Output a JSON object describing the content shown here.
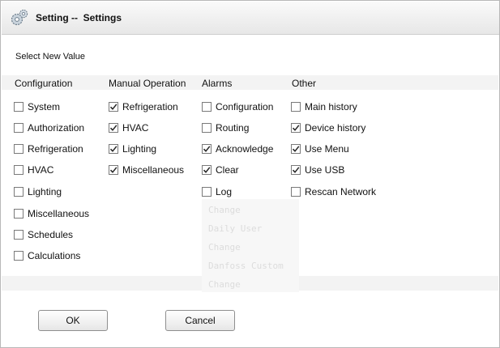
{
  "window": {
    "title": "Setting --  Settings",
    "icon": "gears-icon"
  },
  "subtitle": "Select New Value",
  "columns": [
    {
      "header": "Configuration",
      "items": [
        {
          "label": "System",
          "checked": false
        },
        {
          "label": "Authorization",
          "checked": false
        },
        {
          "label": "Refrigeration",
          "checked": false
        },
        {
          "label": "HVAC",
          "checked": false
        },
        {
          "label": "Lighting",
          "checked": false
        },
        {
          "label": "Miscellaneous",
          "checked": false
        },
        {
          "label": "Schedules",
          "checked": false
        },
        {
          "label": "Calculations",
          "checked": false
        }
      ]
    },
    {
      "header": "Manual Operation",
      "items": [
        {
          "label": "Refrigeration",
          "checked": true
        },
        {
          "label": "HVAC",
          "checked": true
        },
        {
          "label": "Lighting",
          "checked": true
        },
        {
          "label": "Miscellaneous",
          "checked": true
        }
      ]
    },
    {
      "header": "Alarms",
      "items": [
        {
          "label": "Configuration",
          "checked": false
        },
        {
          "label": "Routing",
          "checked": false
        },
        {
          "label": "Acknowledge",
          "checked": true
        },
        {
          "label": "Clear",
          "checked": true
        },
        {
          "label": "Log",
          "checked": false
        }
      ]
    },
    {
      "header": "Other",
      "items": [
        {
          "label": "Main history",
          "checked": false
        },
        {
          "label": "Device history",
          "checked": true
        },
        {
          "label": "Use Menu",
          "checked": true
        },
        {
          "label": "Use USB",
          "checked": true
        },
        {
          "label": "Rescan Network",
          "checked": false
        }
      ]
    }
  ],
  "background_text": [
    "Change",
    "Daily User",
    "Change",
    "Danfoss Custom",
    "Change"
  ],
  "buttons": {
    "ok_label": "OK",
    "cancel_label": "Cancel"
  }
}
